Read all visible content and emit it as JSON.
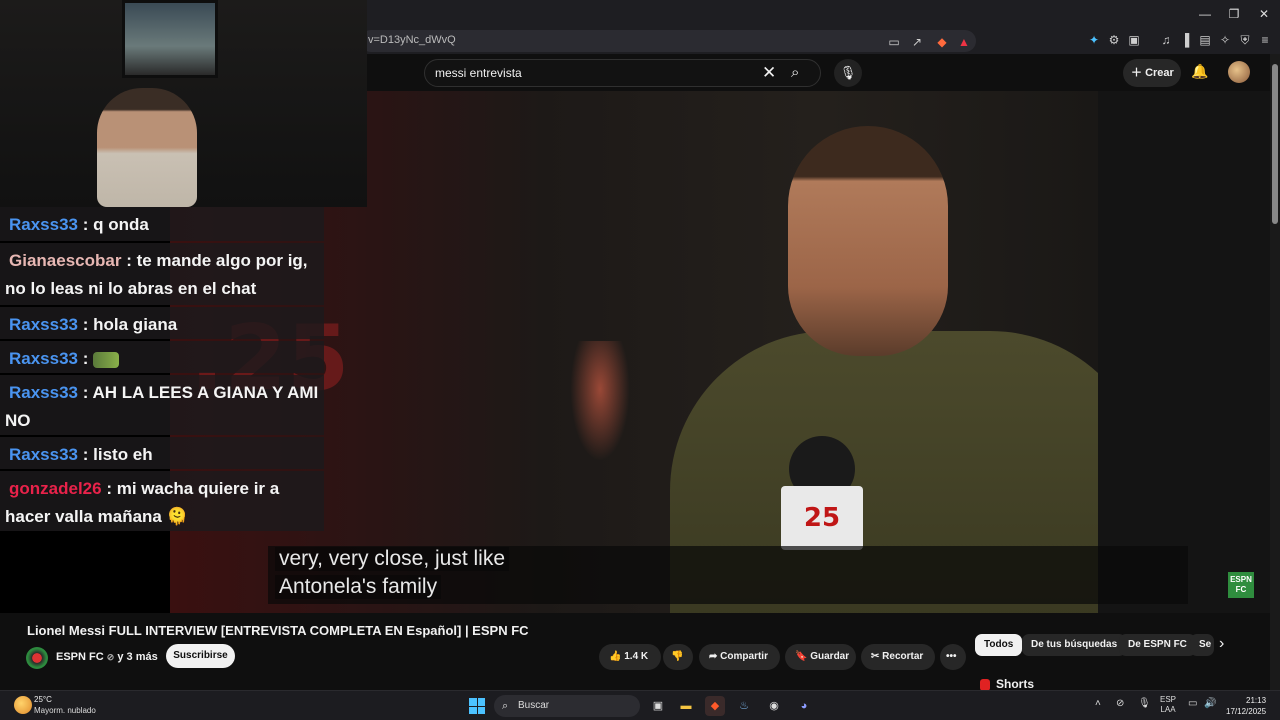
{
  "browser": {
    "url_fragment": "v=D13yNc_dWvQ"
  },
  "youtube": {
    "search_query": "messi entrevista",
    "create_label": "Crear",
    "caption_line1": "very, very close, just like",
    "caption_line2": "Antonela's family",
    "neon_text": ".25",
    "mic_flag_text": "25",
    "watermark_text": "ESPN FC",
    "video_title": "Lionel Messi FULL INTERVIEW [ENTREVISTA COMPLETA EN Español] | ESPN FC",
    "channel_name": "ESPN FC",
    "channel_verified": "⊘",
    "channel_age": "y 3 más",
    "subscribe_label": "Suscribirse",
    "likes": "1.4 K",
    "share_label": "Compartir",
    "save_label": "Guardar",
    "clip_label": "Recortar",
    "chips": [
      "Todos",
      "De tus búsquedas",
      "De ESPN FC",
      "Se"
    ],
    "shorts_label": "Shorts"
  },
  "chat": [
    {
      "user": "Raxss33",
      "color": "blue",
      "text": ": q onda"
    },
    {
      "user": "Gianaescobar",
      "color": "pink",
      "text": ": te mande algo por ig, no lo leas ni lo abras en el chat"
    },
    {
      "user": "Raxss33",
      "color": "blue",
      "text": ": hola giana"
    },
    {
      "user": "Raxss33",
      "color": "blue",
      "text": ": "
    },
    {
      "user": "Raxss33",
      "color": "blue",
      "text": ": AH LA LEES A GIANA Y AMI NO"
    },
    {
      "user": "Raxss33",
      "color": "blue",
      "text": ": listo eh"
    },
    {
      "user": "gonzadel26",
      "color": "red",
      "text": ": mi wacha quiere ir a hacer valla mañana 🫠"
    }
  ],
  "taskbar": {
    "temperature": "25°C",
    "weather": "Mayorm. nublado",
    "search_label": "Buscar",
    "lang_top": "ESP",
    "lang_bottom": "LAA",
    "time": "21:13",
    "date": "17/12/2025"
  },
  "colors": {
    "chat_blue": "#4a94f0",
    "chat_pink": "#e7b7b3",
    "chat_red": "#e8224a",
    "youtube_bg": "#0f0f0f"
  }
}
